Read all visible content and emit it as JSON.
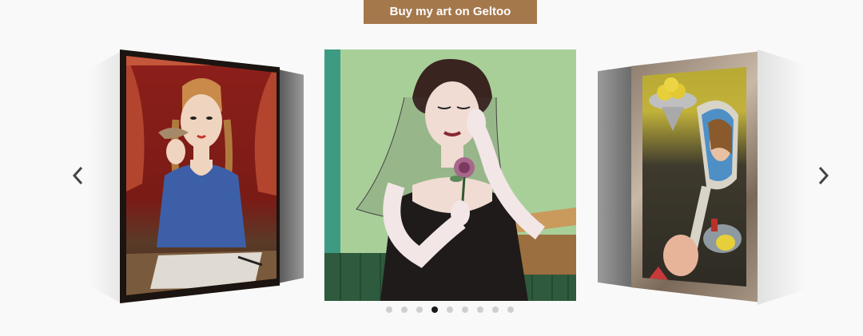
{
  "cta": {
    "label": "Buy my art on Geltoo"
  },
  "carousel": {
    "prev_icon": "chevron-left-icon",
    "next_icon": "chevron-right-icon",
    "slide_count": 9,
    "active_index": 3,
    "slides": [
      {
        "position": "left",
        "subject": "woman with bird painting"
      },
      {
        "position": "center",
        "subject": "woman with veil holding rose painting"
      },
      {
        "position": "right",
        "subject": "mirror reflection with lemons painting"
      }
    ]
  },
  "colors": {
    "cta_background": "#a5784c",
    "dot_inactive": "#cfcfcf",
    "dot_active": "#1a1a1a",
    "chevron": "#444444"
  }
}
